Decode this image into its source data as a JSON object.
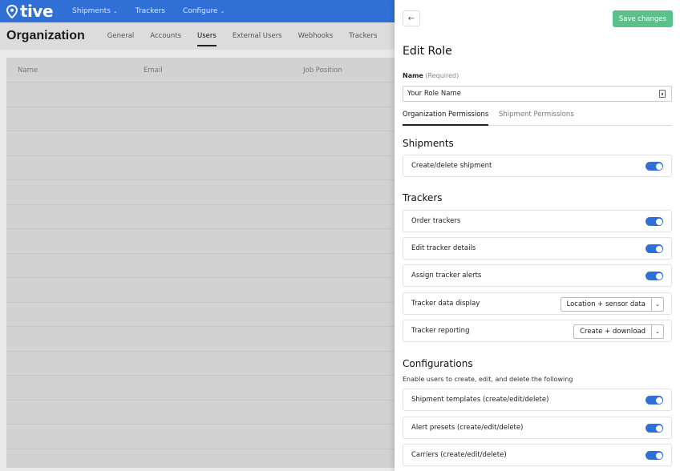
{
  "nav": {
    "logo": "tive",
    "items": [
      {
        "label": "Shipments",
        "dropdown": true
      },
      {
        "label": "Trackers",
        "dropdown": false
      },
      {
        "label": "Configure",
        "dropdown": true
      }
    ]
  },
  "org": {
    "title": "Organization",
    "tabs": [
      "General",
      "Accounts",
      "Users",
      "External Users",
      "Webhooks",
      "Trackers"
    ],
    "active_tab": "Users"
  },
  "table": {
    "columns": [
      "Name",
      "Email",
      "Job Position"
    ]
  },
  "drawer": {
    "back_icon": "arrow-left-icon",
    "save_label": "Save changes",
    "title": "Edit Role",
    "name_label": "Name",
    "name_required": "(Required)",
    "name_value": "Your Role Name",
    "tabs": [
      "Organization Permissions",
      "Shipment Permissions"
    ],
    "active_tab": "Organization Permissions",
    "sections": {
      "shipments": {
        "title": "Shipments",
        "items": [
          {
            "label": "Create/delete shipment",
            "enabled": true
          }
        ]
      },
      "trackers": {
        "title": "Trackers",
        "items": [
          {
            "label": "Order trackers",
            "enabled": true
          },
          {
            "label": "Edit tracker details",
            "enabled": true
          },
          {
            "label": "Assign tracker alerts",
            "enabled": true
          },
          {
            "label": "Tracker data display",
            "select": "Location + sensor data"
          },
          {
            "label": "Tracker reporting",
            "select": "Create + download"
          }
        ]
      },
      "configurations": {
        "title": "Configurations",
        "subtitle": "Enable users to create, edit, and delete the following",
        "items": [
          {
            "label": "Shipment templates (create/edit/delete)",
            "enabled": true
          },
          {
            "label": "Alert presets (create/edit/delete)",
            "enabled": true
          },
          {
            "label": "Carriers (create/edit/delete)",
            "enabled": true
          }
        ]
      }
    }
  },
  "colors": {
    "brand": "#2f6fd6",
    "save": "#5cc08a",
    "toggle_on": "#2f6fd6"
  }
}
